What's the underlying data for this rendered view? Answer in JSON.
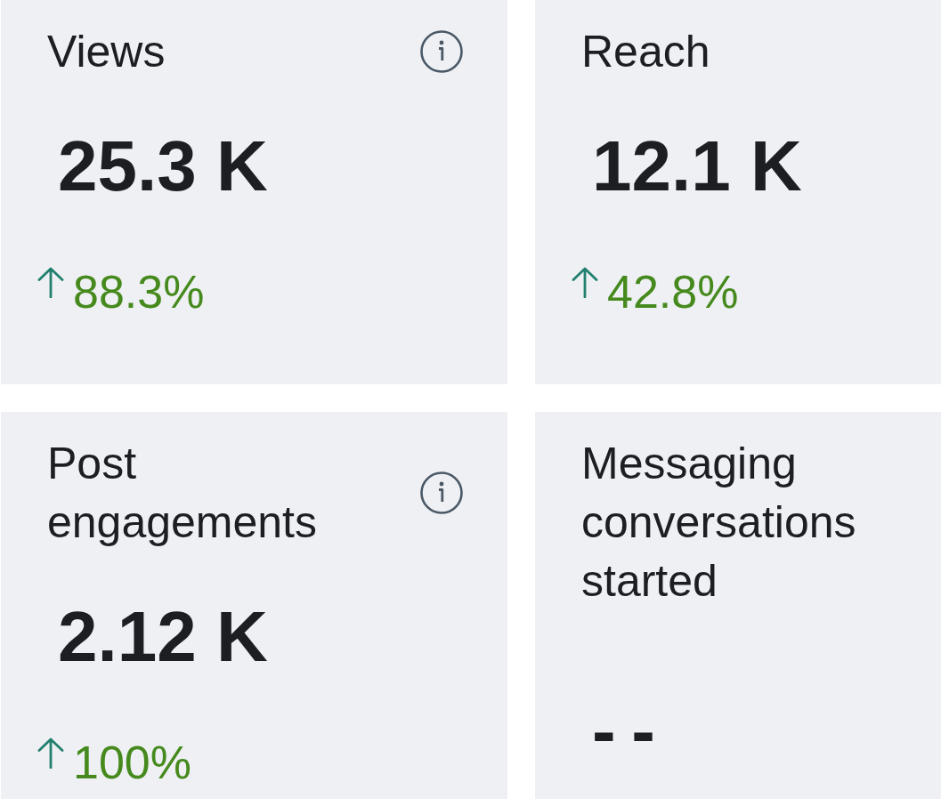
{
  "cards": [
    {
      "title": "Views",
      "info": true,
      "value": "25.3 K",
      "delta": {
        "rising": true,
        "text": "88.3%"
      }
    },
    {
      "title": "Reach",
      "info": false,
      "value": "12.1 K",
      "delta": {
        "rising": true,
        "text": "42.8%"
      }
    },
    {
      "title": "Post engagements",
      "info": true,
      "value": "2.12 K",
      "delta": {
        "rising": true,
        "text": "100%"
      }
    },
    {
      "title": "Messaging conversations started",
      "info": false,
      "value": "--"
    }
  ]
}
